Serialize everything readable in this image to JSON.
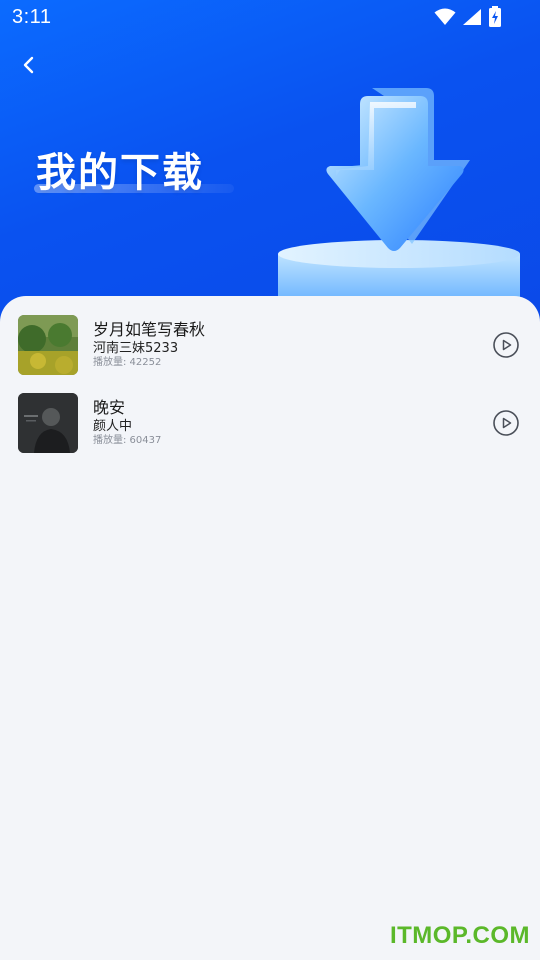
{
  "status_bar": {
    "time": "3:11"
  },
  "header": {
    "title": "我的下载"
  },
  "songs": [
    {
      "title": "岁月如笔写春秋",
      "artist": "河南三妹5233",
      "plays": "播放量: 42252"
    },
    {
      "title": "晚安",
      "artist": "颜人中",
      "plays": "播放量: 60437"
    }
  ],
  "icons": {
    "back": "chevron-left-icon",
    "play": "play-circle-icon",
    "wifi": "wifi-icon",
    "signal": "signal-icon",
    "battery": "battery-charging-icon"
  },
  "colors": {
    "header_blue": "#0a52f0",
    "background": "#f3f5f9",
    "watermark": "#5bb82a"
  },
  "watermark": "ITMOP.COM"
}
